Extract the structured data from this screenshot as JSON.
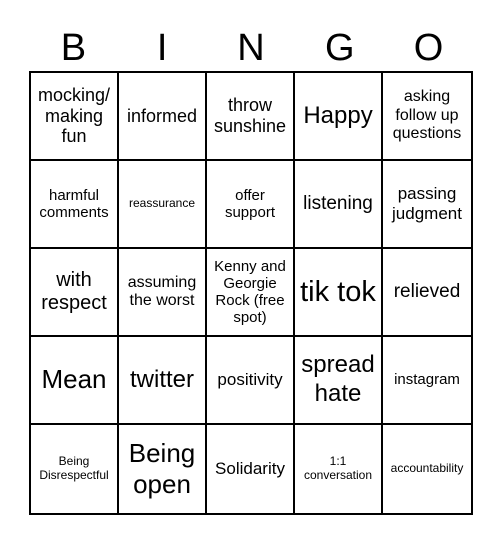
{
  "header": [
    "B",
    "I",
    "N",
    "G",
    "O"
  ],
  "cells": [
    "mocking/ making fun",
    "informed",
    "throw sunshine",
    "Happy",
    "asking follow up questions",
    "harmful comments",
    "reassurance",
    "offer support",
    "listening",
    "passing judgment",
    "with respect",
    "assuming the worst",
    "Kenny and Georgie Rock (free spot)",
    "tik tok",
    "relieved",
    "Mean",
    "twitter",
    "positivity",
    "spread hate",
    "instagram",
    "Being Disrespectful",
    "Being open",
    "Solidarity",
    "1:1 conversation",
    "accountability"
  ]
}
